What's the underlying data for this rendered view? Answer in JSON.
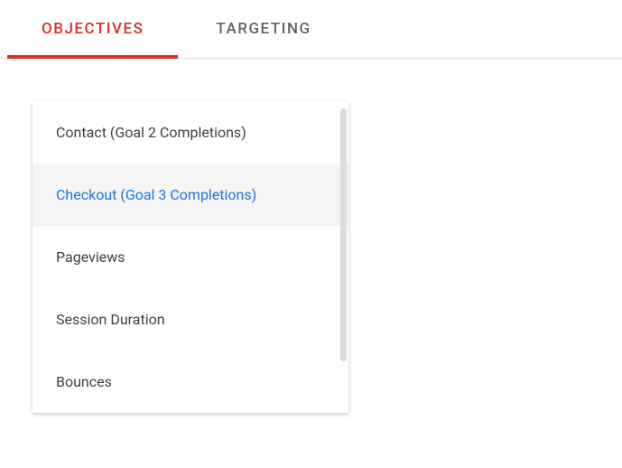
{
  "tabs": {
    "objectives": "OBJECTIVES",
    "targeting": "TARGETING"
  },
  "dropdown": {
    "items": [
      {
        "label": "Contact (Goal 2 Completions)",
        "selected": false
      },
      {
        "label": "Checkout (Goal 3 Completions)",
        "selected": true
      },
      {
        "label": "Pageviews",
        "selected": false
      },
      {
        "label": "Session Duration",
        "selected": false
      },
      {
        "label": "Bounces",
        "selected": false
      }
    ]
  }
}
